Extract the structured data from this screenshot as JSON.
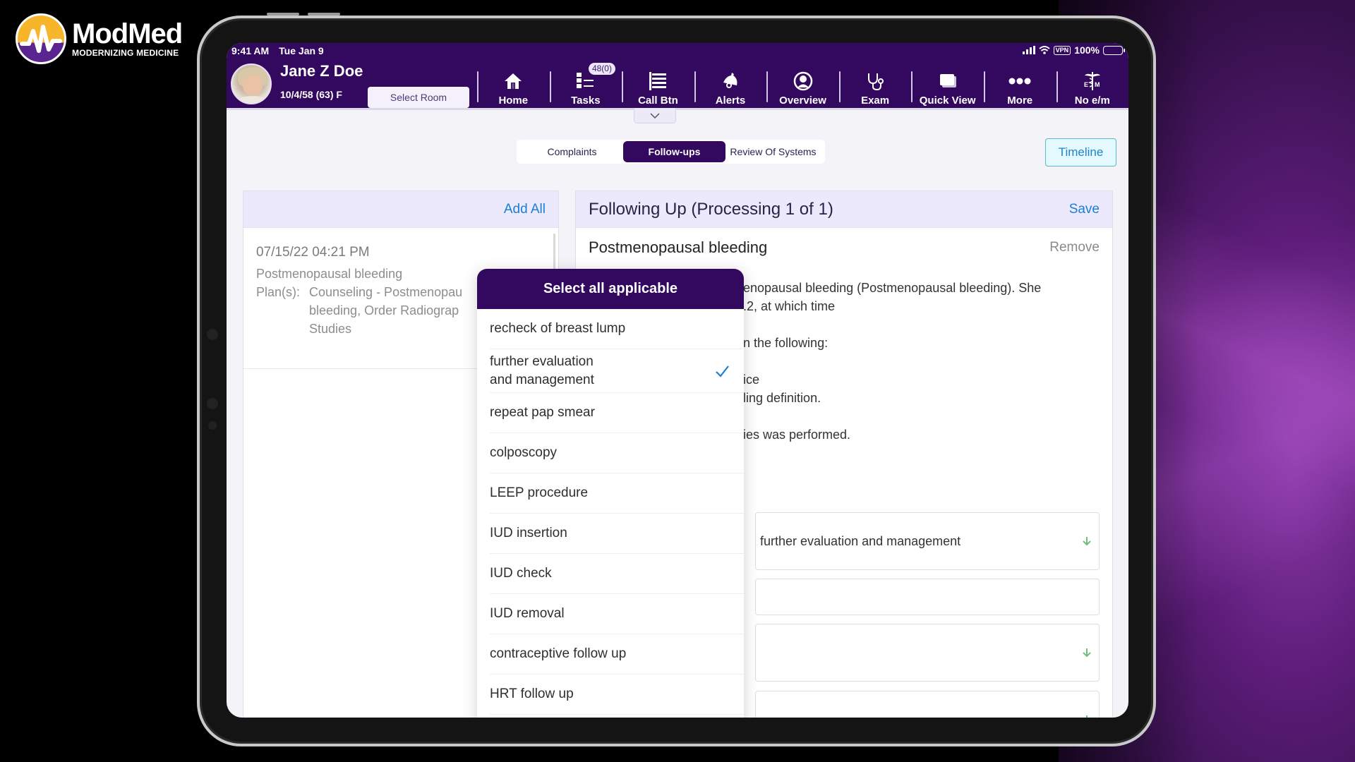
{
  "brand": {
    "name": "ModMed",
    "tagline": "MODERNIZING MEDICINE",
    "colors": {
      "primary": "#33095f",
      "logo_yellow": "#f6b52a",
      "logo_purple": "#5a2590",
      "link": "#1a7fd3",
      "accent_arrow": "#6dbf7e"
    }
  },
  "status_bar": {
    "time": "9:41 AM",
    "date": "Tue Jan 9",
    "vpn": "VPN",
    "battery": "100%",
    "battery_level": 1.0
  },
  "patient": {
    "name": "Jane Z Doe",
    "dob_age_sex": "10/4/58 (63) F",
    "select_room": "Select Room"
  },
  "nav": [
    {
      "label": "Home",
      "icon": "home-icon"
    },
    {
      "label": "Tasks",
      "icon": "tasks-icon",
      "badge": "48(0)"
    },
    {
      "label": "Call Btn",
      "icon": "call-button-icon"
    },
    {
      "label": "Alerts",
      "icon": "bell-icon"
    },
    {
      "label": "Overview",
      "icon": "person-circle-icon"
    },
    {
      "label": "Exam",
      "icon": "stethoscope-icon"
    },
    {
      "label": "Quick View",
      "icon": "quick-view-icon"
    },
    {
      "label": "More",
      "icon": "more-dots-icon"
    },
    {
      "label": "No e/m",
      "icon": "caduceus-em-icon"
    }
  ],
  "tabs": [
    {
      "label": "Complaints",
      "active": false
    },
    {
      "label": "Follow-ups",
      "active": true
    },
    {
      "label": "Review Of Systems",
      "active": false
    }
  ],
  "timeline_label": "Timeline",
  "left_panel": {
    "add_all": "Add All",
    "history": {
      "datetime": "07/15/22 04:21 PM",
      "diagnosis": "Postmenopausal bleeding",
      "plans_label": "Plan(s):",
      "plans_line1": "Counseling - Postmenopau",
      "plans_line2": "bleeding, Order Radiograp",
      "plans_line3": "Studies"
    }
  },
  "right_panel": {
    "title": "Following Up (Processing 1 of 1)",
    "save": "Save",
    "condition": "Postmenopausal bleeding",
    "remove": "Remove",
    "text_lines": [
      "enopausal bleeding (Postmenopausal bleeding). She",
      ".2, at which time",
      "n the following:",
      "ice",
      "ling definition.",
      "ies was performed."
    ],
    "fields": [
      {
        "value": "further evaluation and management",
        "has_arrow": true
      },
      {
        "value": "",
        "has_arrow": false
      },
      {
        "value": "",
        "has_arrow": true
      },
      {
        "value": "",
        "has_arrow": true
      }
    ]
  },
  "popup": {
    "title": "Select all applicable",
    "options": [
      {
        "label": "recheck of breast lump",
        "selected": false
      },
      {
        "label": "further evaluation\nand management",
        "line1": "further evaluation",
        "line2": "and management",
        "selected": true
      },
      {
        "label": "repeat pap smear",
        "selected": false
      },
      {
        "label": "colposcopy",
        "selected": false
      },
      {
        "label": "LEEP procedure",
        "selected": false
      },
      {
        "label": "IUD insertion",
        "selected": false
      },
      {
        "label": "IUD check",
        "selected": false
      },
      {
        "label": "IUD removal",
        "selected": false
      },
      {
        "label": "contraceptive follow up",
        "selected": false
      },
      {
        "label": "HRT follow up",
        "selected": false
      }
    ]
  }
}
